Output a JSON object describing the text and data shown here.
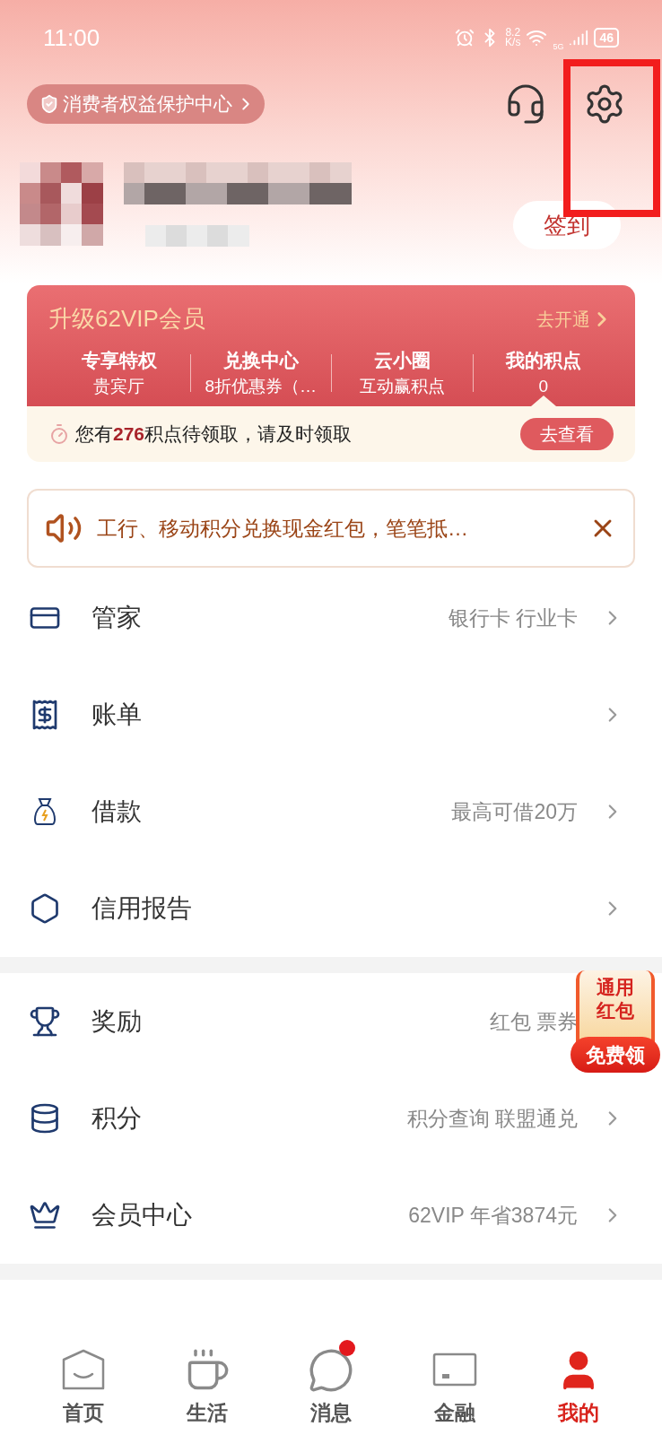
{
  "status_bar": {
    "time": "11:00",
    "net_speed": [
      "8.2",
      "K/s"
    ],
    "network": "5G",
    "battery": "46"
  },
  "header": {
    "consumer_badge": "消费者权益保护中心"
  },
  "profile": {
    "sign_in": "签到"
  },
  "vip_card": {
    "title": "升级62VIP会员",
    "action": "去开通",
    "features": [
      {
        "title": "专享特权",
        "subtitle": "贵宾厅",
        "selected": false
      },
      {
        "title": "兑换中心",
        "subtitle": "8折优惠券（…",
        "selected": false
      },
      {
        "title": "云小圈",
        "subtitle": "互动赢积点",
        "selected": false
      },
      {
        "title": "我的积点",
        "subtitle": "0",
        "selected": true
      }
    ],
    "points_notice": {
      "text": "您有**276**积点待领取，请及时领取",
      "button": "去查看"
    }
  },
  "notice": {
    "text": "工行、移动积分兑换现金红包，笔笔抵…"
  },
  "menu_sections": [
    [
      {
        "kind": "card",
        "label": "管家",
        "detail": "银行卡 行业卡"
      },
      {
        "kind": "bill",
        "label": "账单"
      },
      {
        "kind": "loan",
        "label": "借款",
        "detail": "最高可借20万"
      },
      {
        "kind": "credit",
        "label": "信用报告"
      }
    ],
    [
      {
        "kind": "reward",
        "label": "奖励",
        "detail": "红包 票券"
      },
      {
        "kind": "points",
        "label": "积分",
        "detail": "积分查询 联盟通兑"
      },
      {
        "kind": "member",
        "label": "会员中心",
        "detail": "62VIP 年省3874元"
      }
    ]
  ],
  "floating_badge": {
    "lines": [
      "通用",
      "红包"
    ],
    "button": "免费领"
  },
  "tab_bar": [
    {
      "kind": "home",
      "label": "首页",
      "selected": false,
      "badge": false
    },
    {
      "kind": "life",
      "label": "生活",
      "selected": false,
      "badge": false
    },
    {
      "kind": "message",
      "label": "消息",
      "selected": false,
      "badge": true
    },
    {
      "kind": "finance",
      "label": "金融",
      "selected": false,
      "badge": false
    },
    {
      "kind": "mine",
      "label": "我的",
      "selected": true,
      "badge": false
    }
  ]
}
